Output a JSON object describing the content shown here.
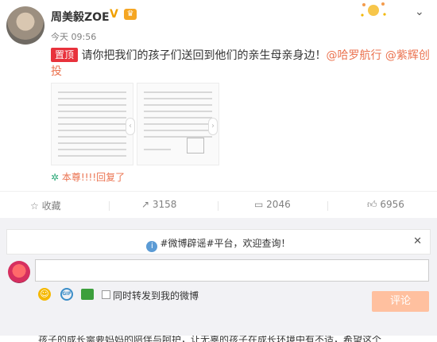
{
  "post": {
    "author": "周美毅ZOE",
    "verified_mark": "V",
    "time": "今天 09:56",
    "pinned_label": "置顶",
    "text_main": "请你把我们的孩子们送回到他们的亲生母亲身边！",
    "mentions": [
      "@哈罗航行",
      "@紫辉创投"
    ],
    "recovered_note": "本尊!!!!回复了"
  },
  "actions": {
    "favorite": "收藏",
    "repost_count": "3158",
    "comment_count": "2046",
    "like_count": "6956"
  },
  "notice": {
    "text": "#微博辟谣#平台，欢迎查询！"
  },
  "composer": {
    "share_label": "同时转发到我的微博",
    "submit_label": "评论"
  },
  "next_comment": {
    "preview": "孩子的成长需要妈妈的陪伴与呵护，让无辜的孩子在成长环境中有不适，希望这个"
  }
}
